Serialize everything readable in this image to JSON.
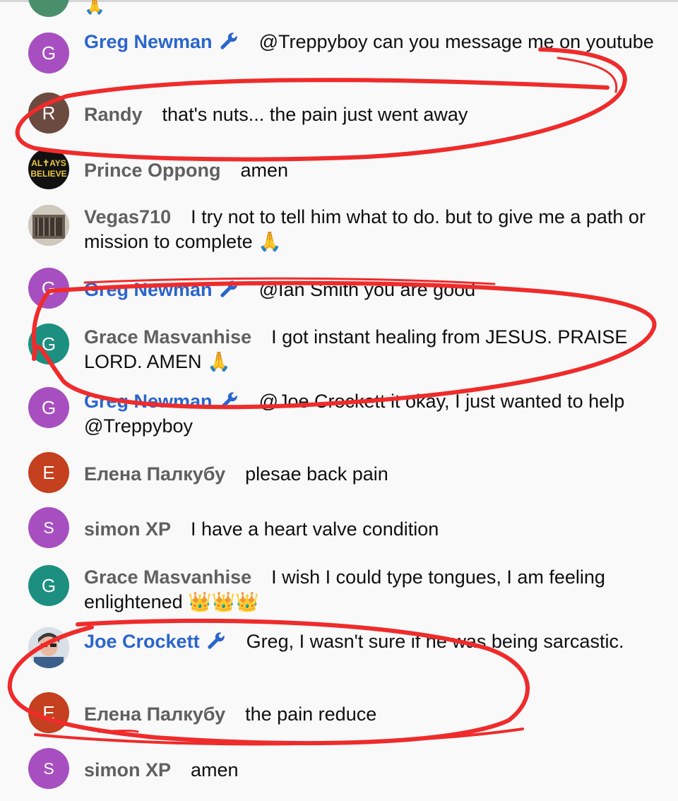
{
  "colors": {
    "author_normal": "#606060",
    "author_moderator": "#2a65cc",
    "scribble": "#ef2b2b"
  },
  "partial_top": {
    "emoji": "🙏"
  },
  "messages": [
    {
      "author": "Greg Newman",
      "moderator": true,
      "avatar_letter": "G",
      "avatar_color": "#a74fc0",
      "text": "@Treppyboy can you message me on youtube"
    },
    {
      "author": "Randy",
      "moderator": false,
      "avatar_letter": "R",
      "avatar_color": "#6b4a40",
      "text": "that's nuts... the pain just went away"
    },
    {
      "author": "Prince Oppong",
      "moderator": false,
      "avatar_letter": "ALWAYS BELIEVE",
      "avatar_color": "#111111",
      "text": "amen"
    },
    {
      "author": "Vegas710",
      "moderator": false,
      "avatar_letter": "",
      "avatar_color": "#8a7d70",
      "text": "I try not to tell him what to do. but to give me a path or mission to complete 🙏"
    },
    {
      "author": "Greg Newman",
      "moderator": true,
      "avatar_letter": "G",
      "avatar_color": "#a74fc0",
      "text": "@Ian Smith you are good"
    },
    {
      "author": "Grace Masvanhise",
      "moderator": false,
      "avatar_letter": "G",
      "avatar_color": "#1d8f80",
      "text": "I got instant healing from JESUS. PRAISE LORD. AMEN 🙏"
    },
    {
      "author": "Greg Newman",
      "moderator": true,
      "avatar_letter": "G",
      "avatar_color": "#a74fc0",
      "text": "@Joe Crockett it okay, I just wanted to help @Treppyboy"
    },
    {
      "author": "Елена Палкубу",
      "moderator": false,
      "avatar_letter": "E",
      "avatar_color": "#c4401e",
      "text": "plesae back pain"
    },
    {
      "author": "simon XP",
      "moderator": false,
      "avatar_letter": "S",
      "avatar_color": "#a74fc0",
      "text": "I have a heart valve condition"
    },
    {
      "author": "Grace Masvanhise",
      "moderator": false,
      "avatar_letter": "G",
      "avatar_color": "#1d8f80",
      "text": "I wish I could type tongues, I am feeling enlightened 👑👑👑"
    },
    {
      "author": "Joe Crockett",
      "moderator": true,
      "avatar_letter": "",
      "avatar_color": "#8aa0b8",
      "text": "Greg, I wasn't sure if he was being sarcastic."
    },
    {
      "author": "Елена Палкубу",
      "moderator": false,
      "avatar_letter": "E",
      "avatar_color": "#c4401e",
      "text": "the pain reduce"
    },
    {
      "author": "simon XP",
      "moderator": false,
      "avatar_letter": "S",
      "avatar_color": "#a74fc0",
      "text": "amen"
    }
  ]
}
